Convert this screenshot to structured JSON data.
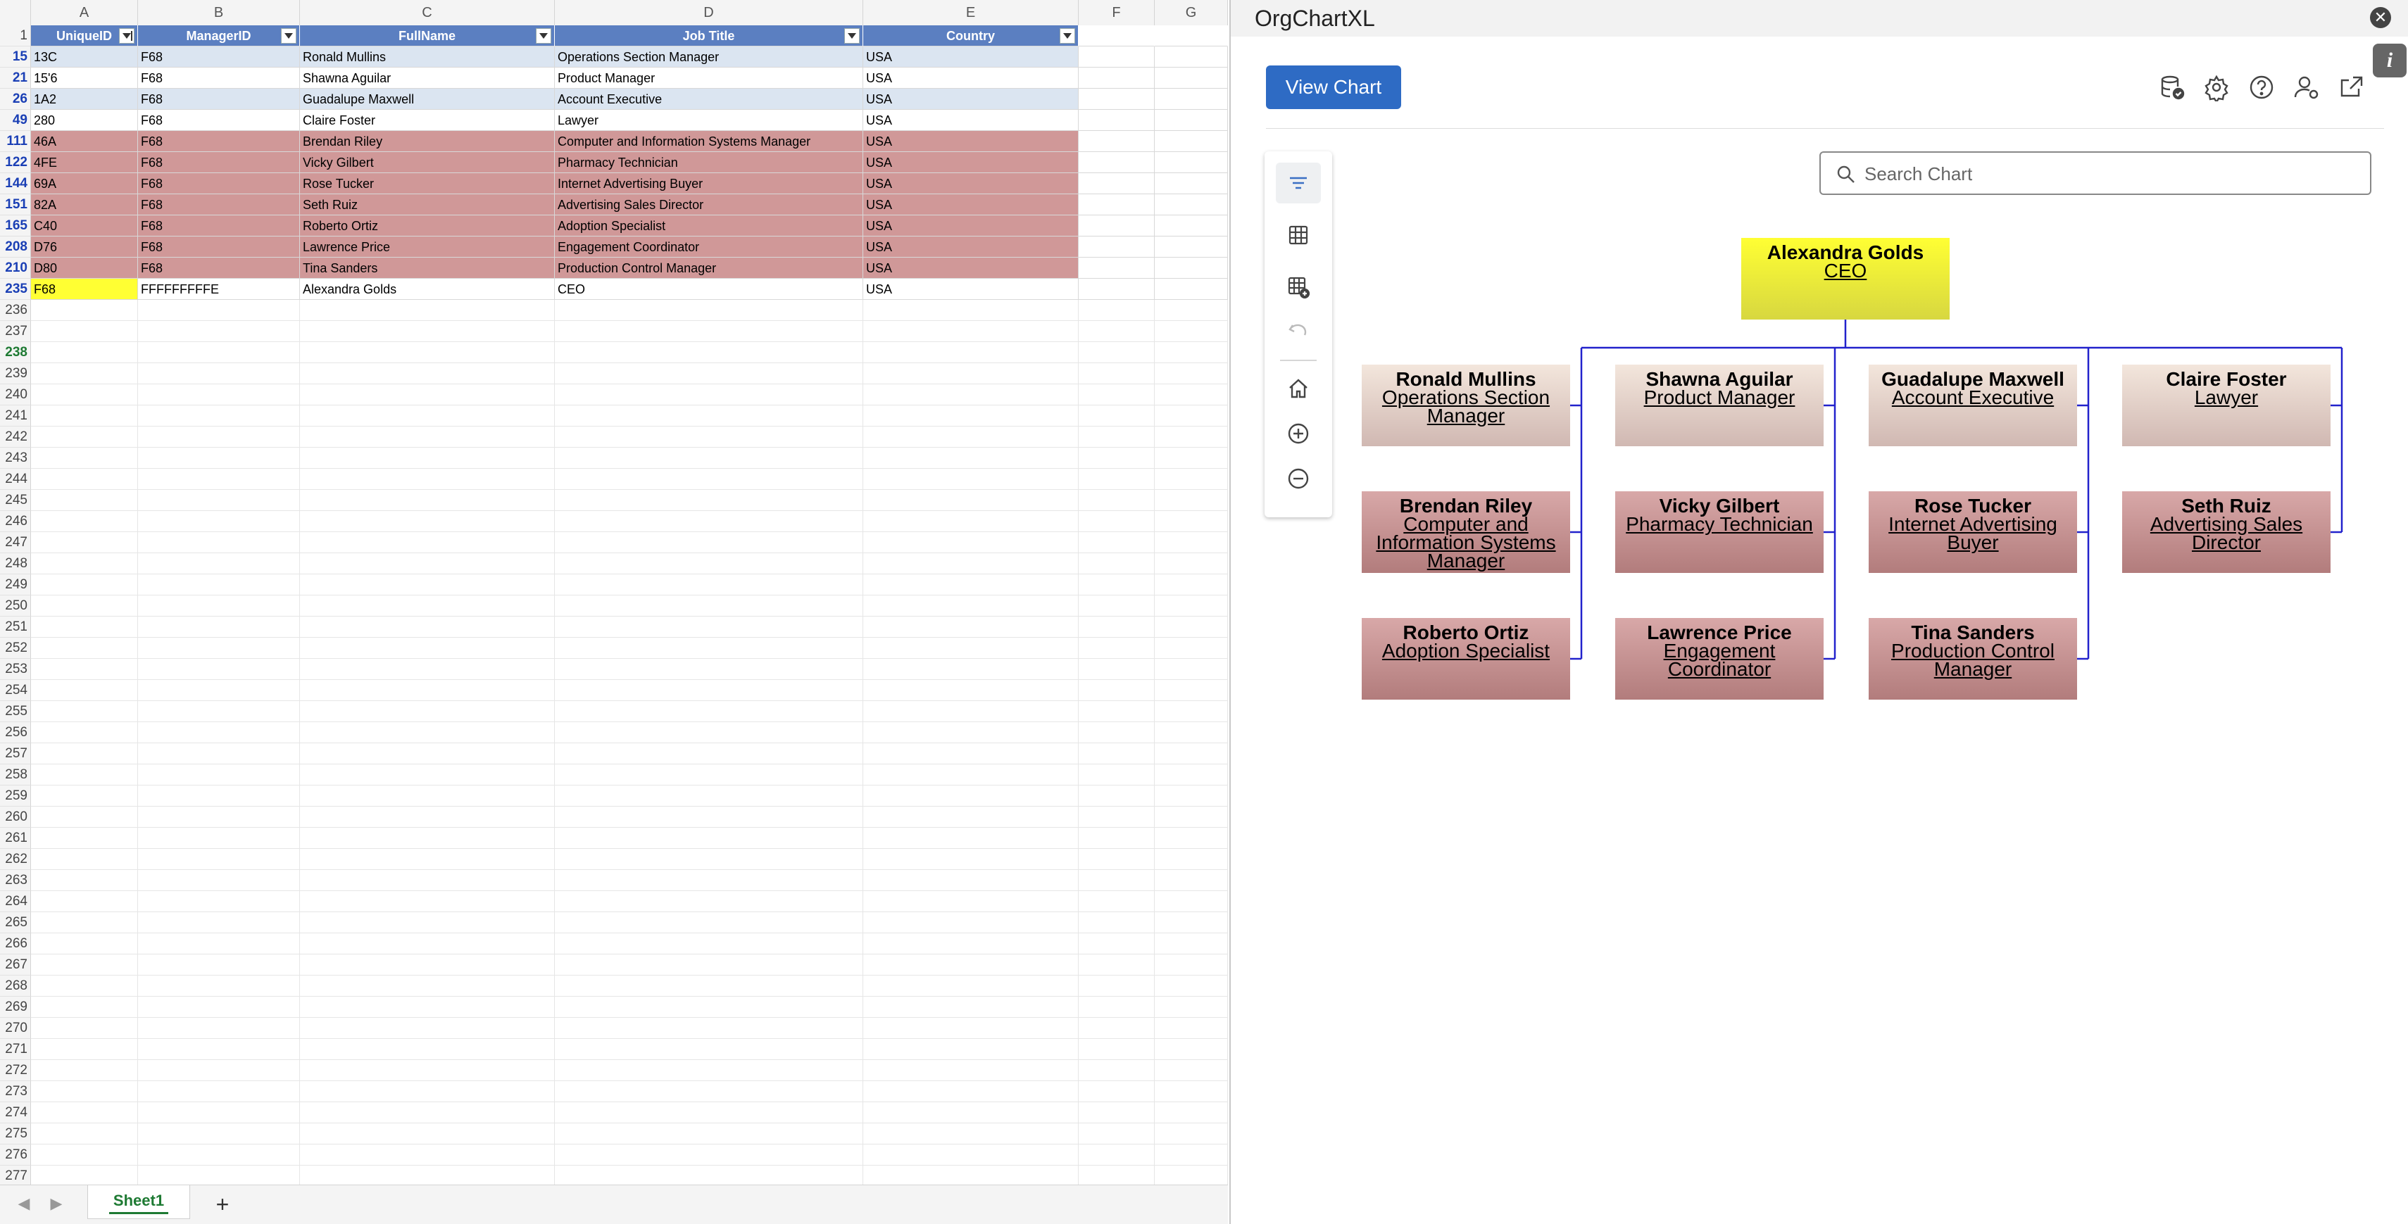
{
  "spreadsheet": {
    "columns": [
      "A",
      "B",
      "C",
      "D",
      "E",
      "F",
      "G"
    ],
    "headers": [
      "UniqueID",
      "ManagerID",
      "FullName",
      "Job Title",
      "Country"
    ],
    "rows": [
      {
        "num": "15",
        "id": "13C",
        "manager": "F68",
        "name": "Ronald Mullins",
        "title": "Operations Section Manager",
        "country": "USA"
      },
      {
        "num": "21",
        "id": "15'6",
        "manager": "F68",
        "name": "Shawna Aguilar",
        "title": "Product Manager",
        "country": "USA"
      },
      {
        "num": "26",
        "id": "1A2",
        "manager": "F68",
        "name": "Guadalupe Maxwell",
        "title": "Account Executive",
        "country": "USA"
      },
      {
        "num": "49",
        "id": "280",
        "manager": "F68",
        "name": "Claire Foster",
        "title": "Lawyer",
        "country": "USA"
      },
      {
        "num": "111",
        "id": "46A",
        "manager": "F68",
        "name": "Brendan Riley",
        "title": "Computer and Information Systems Manager",
        "country": "USA"
      },
      {
        "num": "122",
        "id": "4FE",
        "manager": "F68",
        "name": "Vicky Gilbert",
        "title": "Pharmacy Technician",
        "country": "USA"
      },
      {
        "num": "144",
        "id": "69A",
        "manager": "F68",
        "name": "Rose Tucker",
        "title": "Internet Advertising Buyer",
        "country": "USA"
      },
      {
        "num": "151",
        "id": "82A",
        "manager": "F68",
        "name": "Seth Ruiz",
        "title": "Advertising Sales Director",
        "country": "USA"
      },
      {
        "num": "165",
        "id": "C40",
        "manager": "F68",
        "name": "Roberto Ortiz",
        "title": "Adoption Specialist",
        "country": "USA"
      },
      {
        "num": "208",
        "id": "D76",
        "manager": "F68",
        "name": "Lawrence Price",
        "title": "Engagement Coordinator",
        "country": "USA"
      },
      {
        "num": "210",
        "id": "D80",
        "manager": "F68",
        "name": "Tina Sanders",
        "title": "Production Control Manager",
        "country": "USA"
      },
      {
        "num": "235",
        "id": "F68",
        "manager": "FFFFFFFFFE",
        "name": "Alexandra Golds",
        "title": "CEO",
        "country": "USA"
      }
    ],
    "empty_row_numbers": [
      "236",
      "237",
      "238",
      "239",
      "240",
      "241",
      "242",
      "243",
      "244",
      "245",
      "246",
      "247",
      "248",
      "249",
      "250",
      "251",
      "252",
      "253",
      "254",
      "255",
      "256",
      "257",
      "258",
      "259",
      "260",
      "261",
      "262",
      "263",
      "264",
      "265",
      "266",
      "267",
      "268",
      "269",
      "270",
      "271",
      "272",
      "273",
      "274",
      "275",
      "276",
      "277"
    ],
    "header_row_number": "1",
    "sheet_tab": "Sheet1",
    "add_sheet": "+"
  },
  "pane": {
    "title": "OrgChartXL",
    "close_glyph": "✕",
    "info_glyph": "i",
    "view_chart_label": "View Chart",
    "search_placeholder": "Search Chart",
    "top_icons": [
      "database-check-icon",
      "settings-gear-icon",
      "help-question-icon",
      "user-settings-icon",
      "share-export-icon"
    ],
    "toolbar_icons": [
      "filter-lines-icon",
      "table-grid-icon",
      "table-add-icon",
      "undo-icon",
      "home-icon",
      "zoom-in-icon",
      "zoom-out-icon"
    ]
  },
  "org_chart": {
    "root": {
      "name": "Alexandra Golds",
      "title": "CEO"
    },
    "reports": [
      {
        "name": "Ronald Mullins",
        "title": "Operations Section Manager"
      },
      {
        "name": "Shawna Aguilar",
        "title": "Product Manager"
      },
      {
        "name": "Guadalupe Maxwell",
        "title": "Account Executive"
      },
      {
        "name": "Claire Foster",
        "title": "Lawyer"
      },
      {
        "name": "Brendan Riley",
        "title": "Computer and Information Systems Manager"
      },
      {
        "name": "Vicky Gilbert",
        "title": "Pharmacy Technician"
      },
      {
        "name": "Rose Tucker",
        "title": "Internet Advertising Buyer"
      },
      {
        "name": "Seth Ruiz",
        "title": "Advertising Sales Director"
      },
      {
        "name": "Roberto Ortiz",
        "title": "Adoption Specialist"
      },
      {
        "name": "Lawrence Price",
        "title": "Engagement Coordinator"
      },
      {
        "name": "Tina Sanders",
        "title": "Production Control Manager"
      }
    ],
    "colors": {
      "ceo": "#ffff33",
      "tan": "#e8d6cc",
      "red": "#c48e8e",
      "connector": "#2222cc"
    }
  }
}
